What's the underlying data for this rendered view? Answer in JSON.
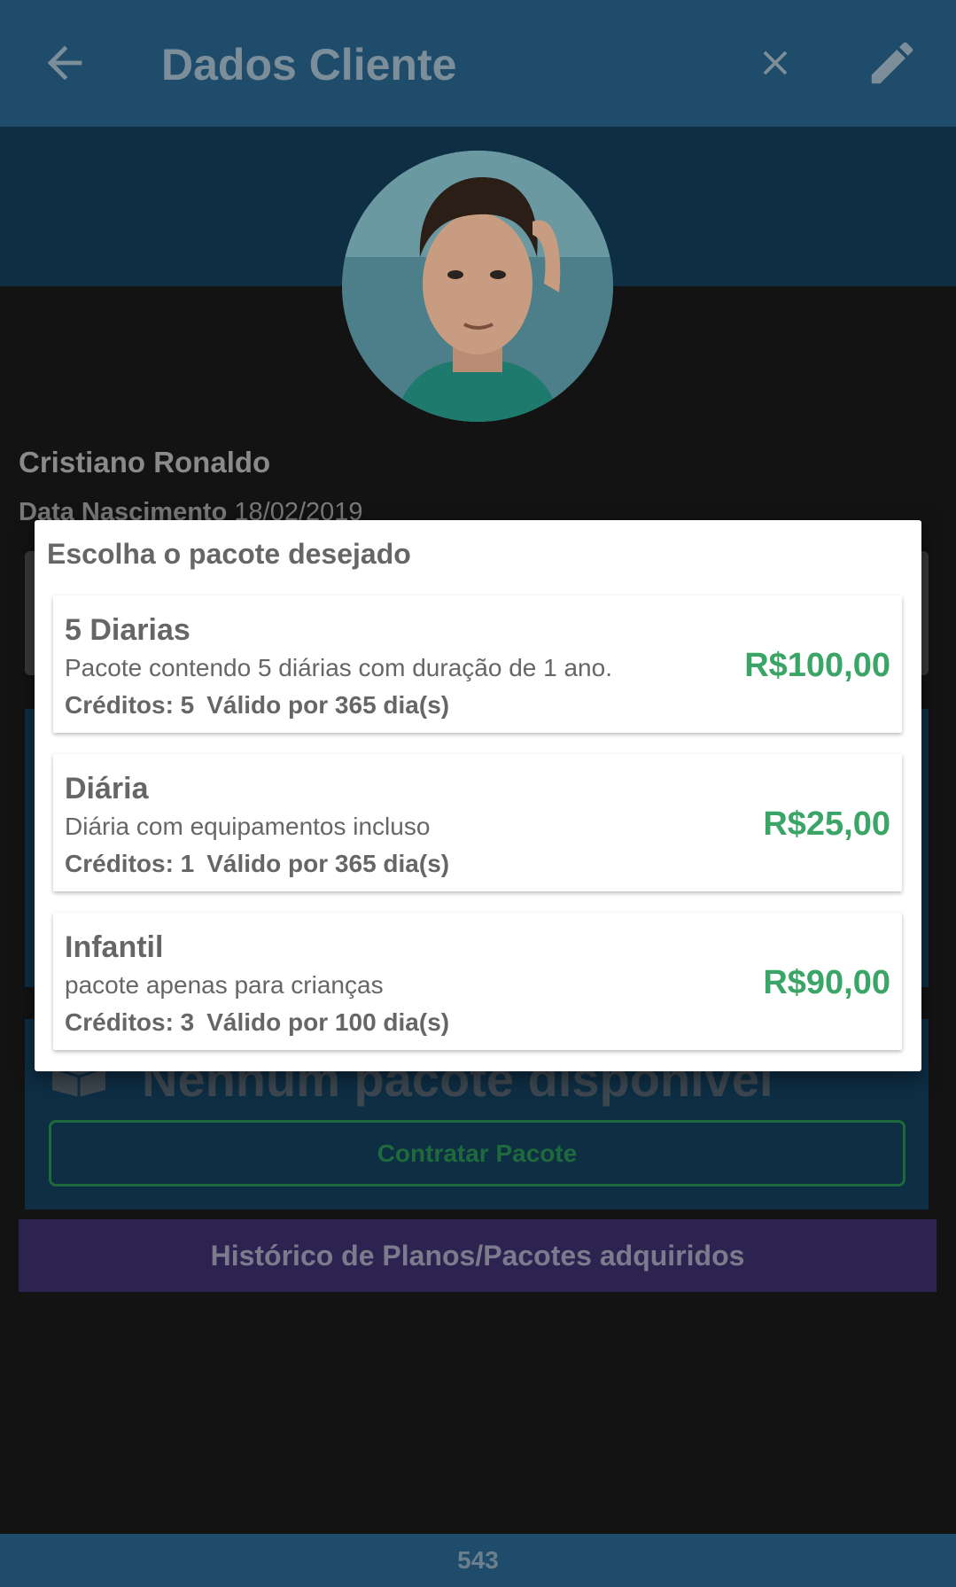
{
  "app_bar": {
    "title": "Dados Cliente",
    "icons": {
      "back": "arrow-left-icon",
      "close": "close-icon",
      "edit": "pencil-icon"
    },
    "color": "#1f4c6a"
  },
  "client": {
    "name": "Cristiano Ronaldo",
    "birth_label": "Data Nascimento",
    "birth_date": "18/02/2019"
  },
  "packages_section": {
    "empty_text": "Nenhum pacote disponível",
    "contract_button": "Contratar Pacote"
  },
  "history_button": "Histórico de Planos/Pacotes adquiridos",
  "bottom_bar": {
    "text": "543"
  },
  "dialog": {
    "title": "Escolha o pacote desejado",
    "packages": [
      {
        "name": "5 Diarias",
        "description": "Pacote contendo 5 diárias com duração de 1 ano.",
        "credits": "Créditos: 5",
        "validity": "Válido por 365 dia(s)",
        "price": "R$100,00"
      },
      {
        "name": "Diária",
        "description": "Diária com equipamentos incluso",
        "credits": "Créditos: 1",
        "validity": "Válido por 365 dia(s)",
        "price": "R$25,00"
      },
      {
        "name": "Infantil",
        "description": "pacote apenas para crianças",
        "credits": "Créditos: 3",
        "validity": "Válido por 100 dia(s)",
        "price": "R$90,00"
      }
    ],
    "price_color": "#3aa566"
  }
}
